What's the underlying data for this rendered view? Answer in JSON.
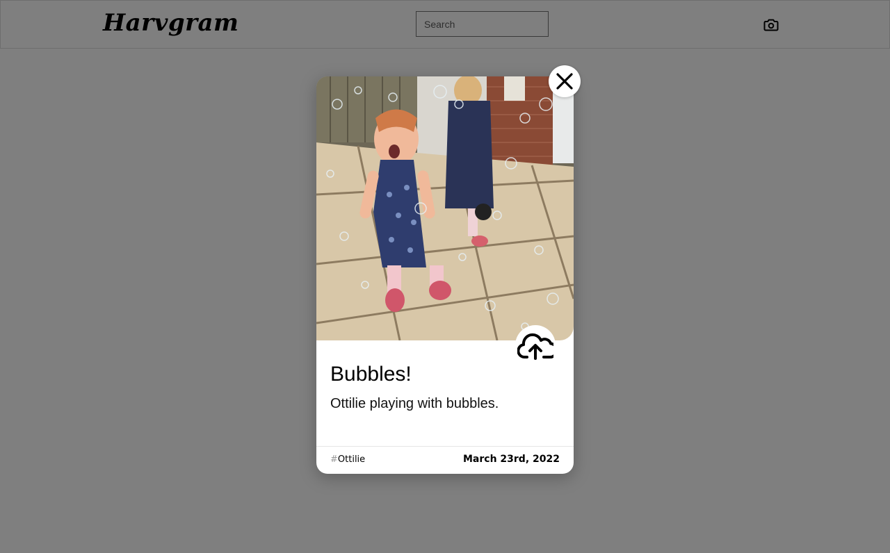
{
  "header": {
    "logo": "Harvgram",
    "search_placeholder": "Search",
    "search_value": "",
    "camera_icon": "camera-icon"
  },
  "modal": {
    "close_icon": "close-icon",
    "upload_icon": "cloud-upload-icon",
    "photo_alt": "Toddler in blue star dress crying on patio with bubbles",
    "title": "Bubbles!",
    "description": "Ottilie playing with bubbles.",
    "tag_hash": "#",
    "tag": "Ottilie",
    "date": "March 23rd, 2022"
  },
  "colors": {
    "backdrop": "#7f7f7f",
    "card": "#ffffff",
    "text": "#000000"
  }
}
